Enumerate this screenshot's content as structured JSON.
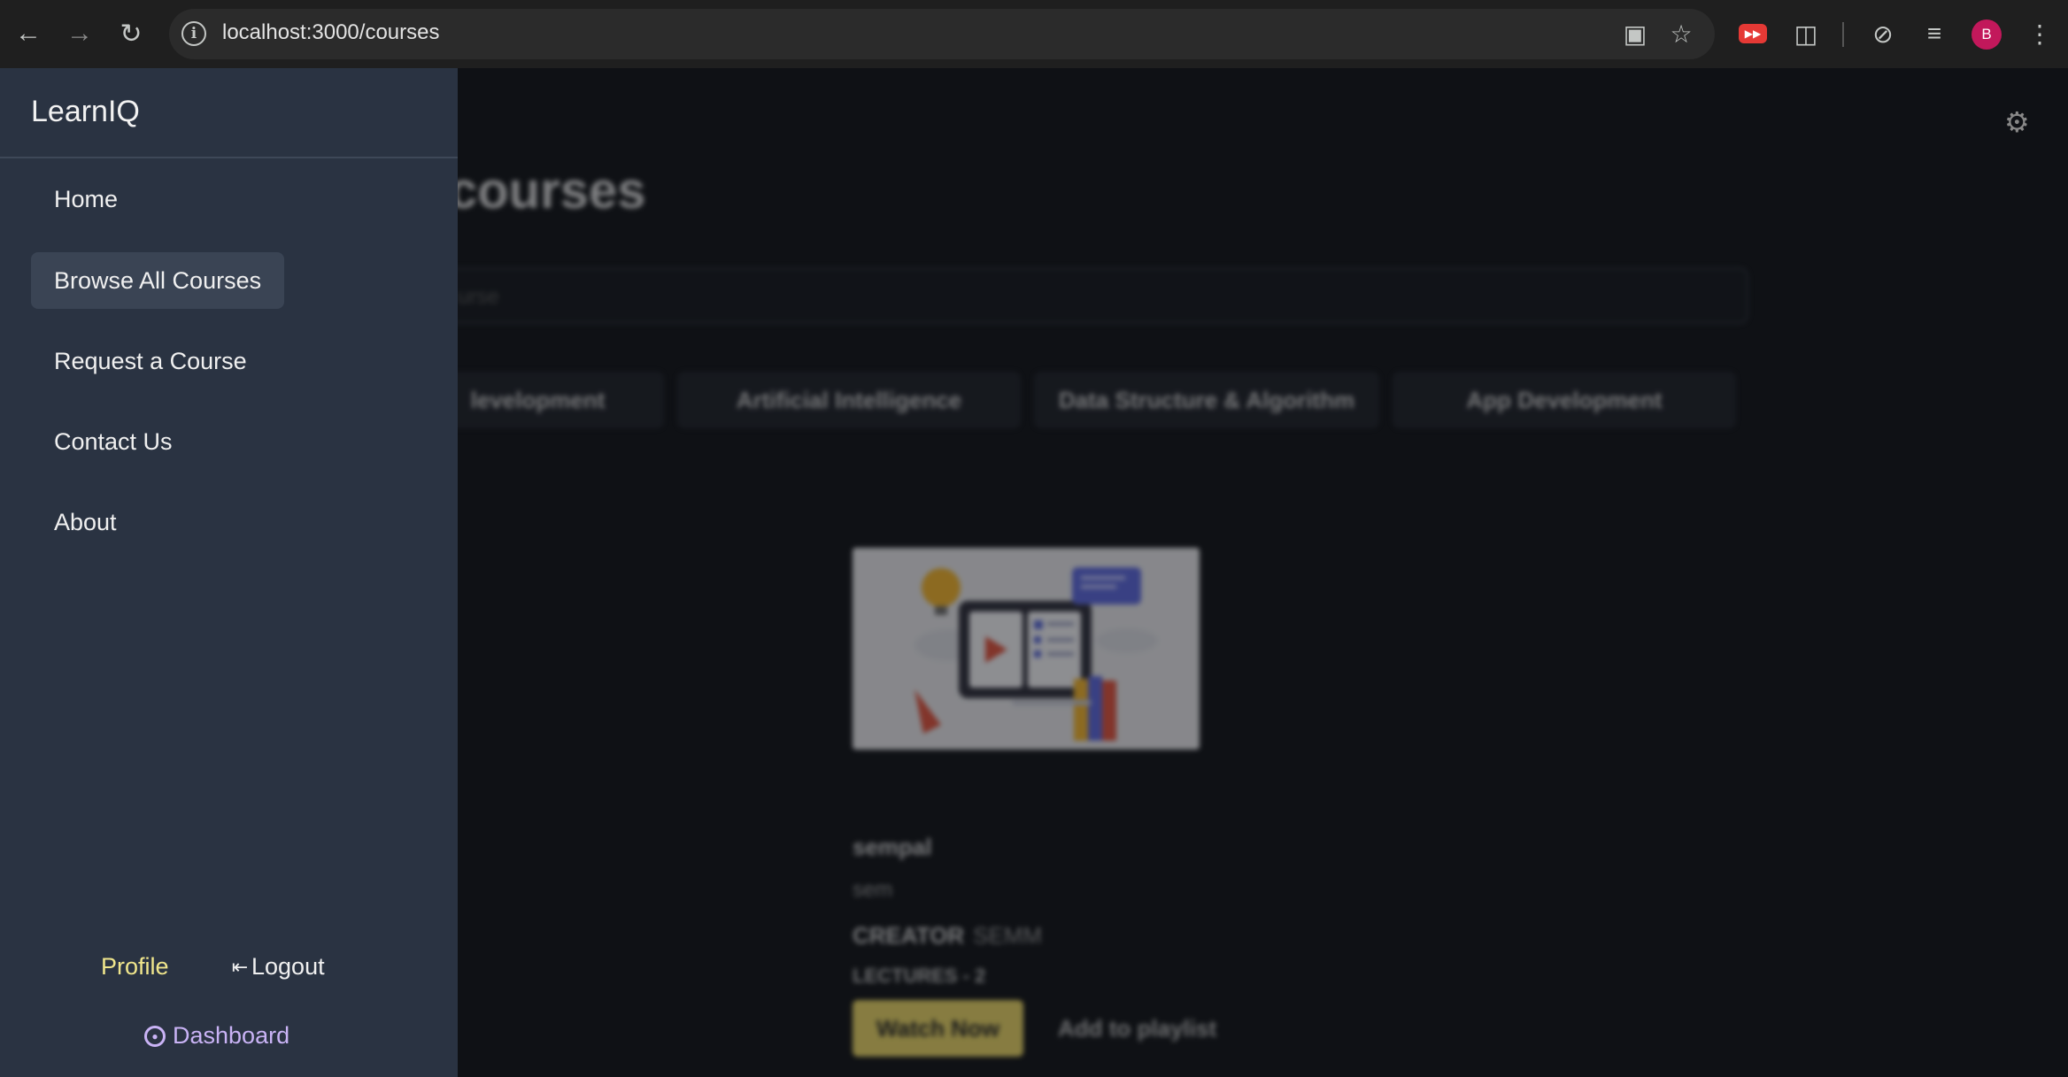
{
  "browser": {
    "url": "localhost:3000/courses",
    "profile_initial": "B",
    "icons": [
      "back-arrow-icon",
      "forward-arrow-icon",
      "reload-icon",
      "site-info-icon",
      "install-app-icon",
      "bookmark-star-icon",
      "youtube-extension-icon",
      "extensions-puzzle-icon",
      "performance-icon",
      "media-queue-icon",
      "kebab-menu-icon"
    ]
  },
  "drawer": {
    "brand": "LearnIQ",
    "items": [
      {
        "label": "Home",
        "active": false
      },
      {
        "label": "Browse All Courses",
        "active": true
      },
      {
        "label": "Request a Course",
        "active": false
      },
      {
        "label": "Contact Us",
        "active": false
      },
      {
        "label": "About",
        "active": false
      }
    ],
    "profile_label": "Profile",
    "logout_label": "Logout",
    "dashboard_label": "Dashboard"
  },
  "page": {
    "title_visible": "courses",
    "search_placeholder": "urse",
    "categories": [
      "levelopment",
      "Artificial Intelligence",
      "Data Structure & Algorithm",
      "App Development"
    ],
    "course": {
      "title": "sempal",
      "description": "sem",
      "creator_label": "CREATOR",
      "creator_value": "SEMM",
      "lectures": "LECTURES - 2",
      "watch_label": "Watch Now",
      "playlist_label": "Add to playlist"
    }
  },
  "colors": {
    "drawer_bg": "#2a3342",
    "page_bg": "#0f1115",
    "accent_yellow": "#e9d565",
    "profile_text": "#f0e68c",
    "dashboard_text": "#c9b3f5"
  }
}
